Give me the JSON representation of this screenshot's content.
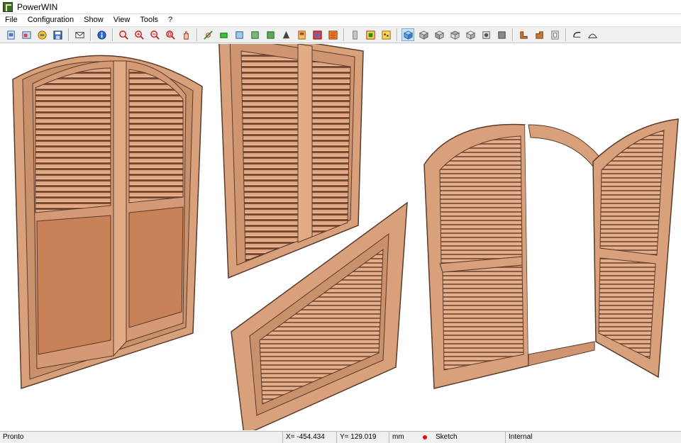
{
  "window": {
    "title": "PowerWIN"
  },
  "menu": [
    "File",
    "Configuration",
    "Show",
    "View",
    "Tools",
    "?"
  ],
  "toolbar": {
    "groups": [
      [
        "new-file",
        "open-file",
        "export",
        "save"
      ],
      [
        "email"
      ],
      [
        "info"
      ],
      [
        "zoom-in",
        "zoom-window",
        "zoom-out",
        "zoom-all",
        "pan"
      ],
      [
        "select-node",
        "green-rect",
        "view-3d-a",
        "view-3d-b",
        "view-3d-c"
      ],
      [
        "print",
        "doors",
        "frame",
        "louver"
      ],
      [
        "panel",
        "color-grid",
        "palette"
      ],
      [
        "cube-iso",
        "cube-front",
        "cube-side",
        "cube-top",
        "cube-back",
        "cube-shaded",
        "cube-solid"
      ],
      [
        "profile-l",
        "profile-corner",
        "profile-frame"
      ],
      [
        "arc-left",
        "arc-dome"
      ]
    ],
    "active": "cube-iso"
  },
  "statusbar": {
    "state": "Pronto",
    "x": "X= -454.434",
    "y": "Y= 129.019",
    "unit": "mm",
    "mode": "Sketch",
    "type": "Internal"
  },
  "colors": {
    "wood_light": "#e3aa86",
    "wood_mid": "#cf9570",
    "wood_dark": "#b27454",
    "panel": "#c98258",
    "outline": "#5a3a2a",
    "accent_selected": "#cfe3f7"
  }
}
